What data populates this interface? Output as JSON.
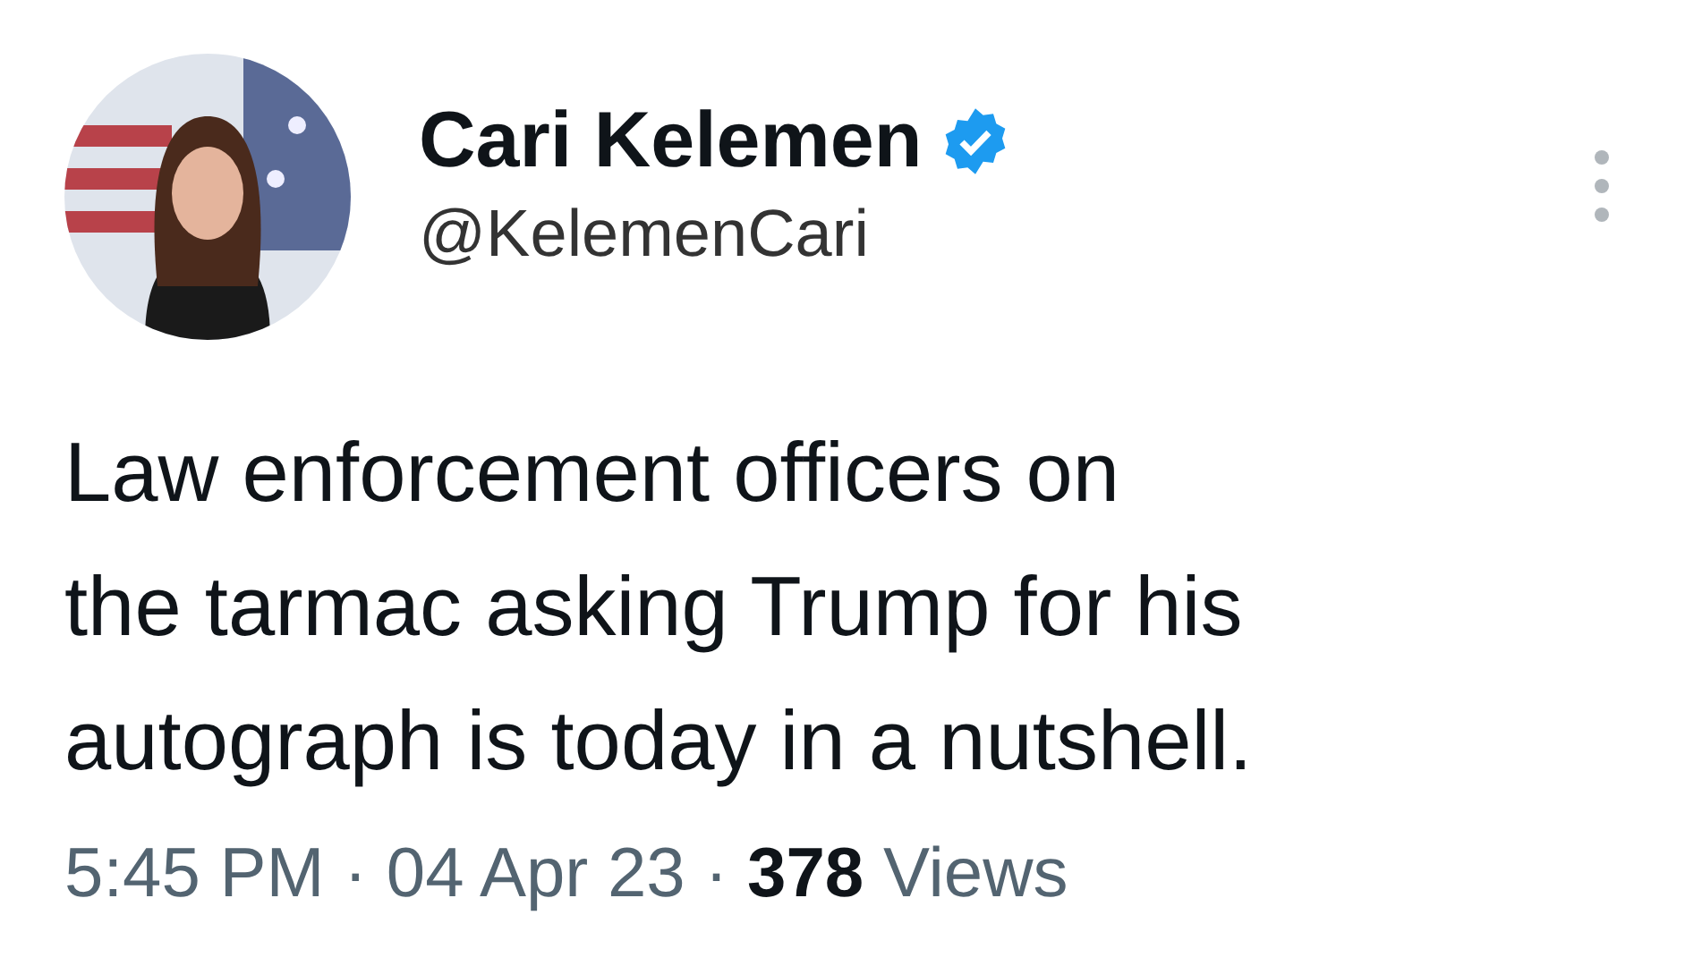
{
  "author": {
    "name": "Cari Kelemen",
    "handle": "@KelemenCari",
    "verified": true
  },
  "tweet": {
    "lines": [
      "Law enforcement officers on",
      "the tarmac asking Trump for his",
      "autograph is today in a nutshell."
    ]
  },
  "meta": "5:45 PM · 04 Apr 23 · **378** Views"
}
